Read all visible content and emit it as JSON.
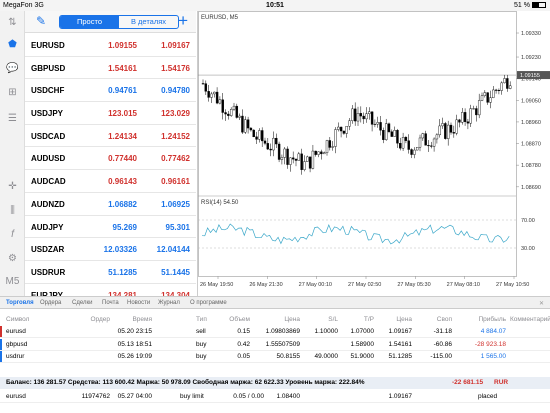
{
  "status": {
    "carrier": "MegaFon",
    "network": "3G",
    "time": "10:51",
    "battery": "51 %",
    "battery_level": 0.51
  },
  "toolbar": {
    "segment_simple": "Просто",
    "segment_detail": "В деталях"
  },
  "quotes": [
    {
      "symbol": "EURUSD",
      "bid": "1.09155",
      "ask": "1.09167",
      "color": "red"
    },
    {
      "symbol": "GBPUSD",
      "bid": "1.54161",
      "ask": "1.54176",
      "color": "red"
    },
    {
      "symbol": "USDCHF",
      "bid": "0.94761",
      "ask": "0.94780",
      "color": "blue"
    },
    {
      "symbol": "USDJPY",
      "bid": "123.015",
      "ask": "123.029",
      "color": "red"
    },
    {
      "symbol": "USDCAD",
      "bid": "1.24134",
      "ask": "1.24152",
      "color": "red"
    },
    {
      "symbol": "AUDUSD",
      "bid": "0.77440",
      "ask": "0.77462",
      "color": "red"
    },
    {
      "symbol": "AUDCAD",
      "bid": "0.96143",
      "ask": "0.96161",
      "color": "red"
    },
    {
      "symbol": "AUDNZD",
      "bid": "1.06882",
      "ask": "1.06925",
      "color": "blue"
    },
    {
      "symbol": "AUDJPY",
      "bid": "95.269",
      "ask": "95.301",
      "color": "blue"
    },
    {
      "symbol": "USDZAR",
      "bid": "12.03326",
      "ask": "12.04144",
      "color": "blue"
    },
    {
      "symbol": "USDRUR",
      "bid": "51.1285",
      "ask": "51.1445",
      "color": "blue"
    },
    {
      "symbol": "EURJPY",
      "bid": "134.281",
      "ask": "134.304",
      "color": "red"
    }
  ],
  "chart": {
    "symbol_label": "EURUSD, M5",
    "rsi_label": "RSI(14) 54.50",
    "price_ticks": [
      "1.09330",
      "1.09230",
      "1.09140",
      "1.09050",
      "1.08960",
      "1.08870",
      "1.08780",
      "1.08690"
    ],
    "price_current": "1.09155",
    "rsi_ticks": [
      "70.00",
      "30.00"
    ],
    "time_ticks": [
      "26 May 19:50",
      "26 May 21:30",
      "27 May 00:10",
      "27 May 02:50",
      "27 May 05:30",
      "27 May 08:10",
      "27 May 10:50"
    ]
  },
  "tabs": {
    "items": [
      "Торговля",
      "Ордера",
      "Сделки",
      "Почта",
      "Новости",
      "Журнал",
      "О программе"
    ],
    "active": "Торговля",
    "close": "✕"
  },
  "table": {
    "headers": [
      "Символ",
      "Ордер",
      "Время",
      "Тип",
      "Объем",
      "Цена",
      "S/L",
      "T/P",
      "Цена",
      "Своп",
      "Прибыль",
      "Комментарий"
    ],
    "rows": [
      {
        "symbol": "eurusd",
        "order": "",
        "time": "05.20 23:15",
        "type": "sell",
        "volume": "0.15",
        "price": "1.09803869",
        "sl": "1.10000",
        "tp": "1.07000",
        "cur": "1.09167",
        "swap": "-31.18",
        "profit": "4 884.07",
        "profit_color": "#1a73e8",
        "mark": "#d0312d"
      },
      {
        "symbol": "gbpusd",
        "order": "",
        "time": "05.13 18:51",
        "type": "buy",
        "volume": "0.42",
        "price": "1.55507509",
        "sl": "",
        "tp": "1.58900",
        "cur": "1.54161",
        "swap": "-60.86",
        "profit": "-28 923.18",
        "profit_color": "#d0312d",
        "mark": "#1a73e8"
      },
      {
        "symbol": "usdrur",
        "order": "",
        "time": "05.26 19:09",
        "type": "buy",
        "volume": "0.05",
        "price": "50.8155",
        "sl": "49.0000",
        "tp": "51.9000",
        "cur": "51.1285",
        "swap": "-115.00",
        "profit": "1 565.00",
        "profit_color": "#1a73e8",
        "mark": "#1a73e8"
      }
    ],
    "balance": "Баланс: 136 281.57 Средства: 113 600.42 Маржа: 50 978.09 Свободная маржа: 62 622.33 Уровень маржа: 222.84%",
    "balance_total": "-22 681.15",
    "balance_currency": "RUR",
    "pending": {
      "symbol": "eurusd",
      "order": "11974762",
      "time": "05.27 04:00",
      "type": "buy limit",
      "volume": "0.05 / 0.00",
      "price": "1.08400",
      "cur": "1.09167",
      "status": "placed"
    }
  },
  "chart_data": {
    "type": "candlestick",
    "x": [
      "26 May 19:50",
      "26 May 21:30",
      "27 May 00:10",
      "27 May 02:50",
      "27 May 05:30",
      "27 May 08:10",
      "27 May 10:50"
    ],
    "close_approx": [
      1.0912,
      1.089,
      1.0878,
      1.09,
      1.0885,
      1.0895,
      1.0915
    ],
    "current_price": 1.09155,
    "ylim": [
      1.0866,
      1.0938
    ],
    "rsi": {
      "label": "RSI(14)",
      "last": 54.5,
      "levels": [
        70,
        30
      ]
    }
  }
}
